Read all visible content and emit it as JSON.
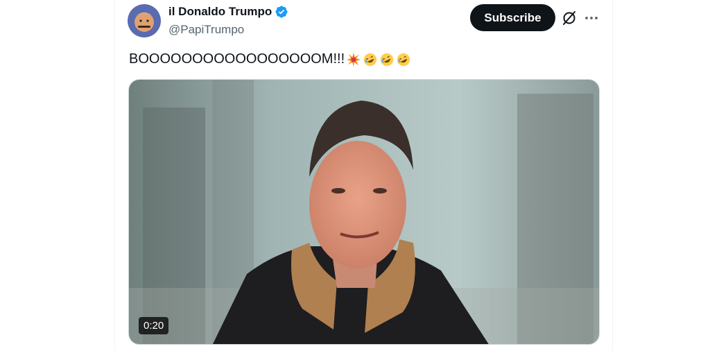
{
  "author": {
    "display_name": "il Donaldo Trumpo",
    "handle": "@PapiTrumpo",
    "verified": true,
    "avatar_icon": "avatar-icon"
  },
  "actions": {
    "subscribe_label": "Subscribe",
    "grok_icon": "grok-icon",
    "more_icon": "more-icon"
  },
  "tweet": {
    "text": "BOOOOOOOOOOOOOOOOOM!!!",
    "emojis": [
      "collision-emoji",
      "rofl-emoji",
      "rofl-emoji",
      "rofl-emoji"
    ]
  },
  "media": {
    "type": "video",
    "duration": "0:20"
  },
  "colors": {
    "verified_blue": "#1d9bf0",
    "primary_text": "#0f1419",
    "secondary_text": "#536471",
    "button_bg": "#0f1419"
  }
}
